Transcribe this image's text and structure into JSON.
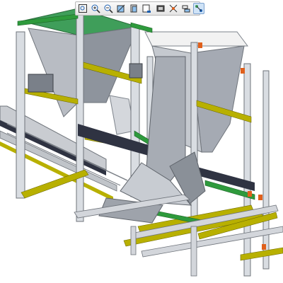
{
  "app": {
    "view": "3d-model-viewport"
  },
  "toolbar": {
    "buttons": [
      {
        "name": "zoom-fit-button",
        "icon": "zoom-fit-icon"
      },
      {
        "name": "zoom-in-button",
        "icon": "zoom-in-icon"
      },
      {
        "name": "zoom-out-button",
        "icon": "zoom-out-icon"
      },
      {
        "name": "normal-view-button",
        "icon": "normal-view-icon"
      },
      {
        "name": "orient-view-button",
        "icon": "orient-view-icon"
      },
      {
        "name": "saved-views-button",
        "icon": "saved-views-icon"
      },
      {
        "name": "display-style-button",
        "icon": "display-style-icon"
      },
      {
        "name": "datum-display-button",
        "icon": "datum-display-icon"
      },
      {
        "name": "spin-center-button",
        "icon": "spin-center-icon"
      },
      {
        "name": "annotation-display-button",
        "icon": "annotation-display-icon",
        "active": true
      }
    ]
  },
  "model": {
    "description_colors": {
      "frame": "#d9dde2",
      "frame_shadow": "#8a9098",
      "hopper": "#9aa0aa",
      "hopper_top_left": "#3f9e5a",
      "hopper_top_right": "#f2f2f2",
      "rail_yellow": "#b8b000",
      "rail_green": "#2e9a3c",
      "belt_dark": "#2f3342",
      "plate_orange": "#e0601c",
      "accent_blue": "#2f3fa0",
      "background": "#ffffff"
    }
  }
}
